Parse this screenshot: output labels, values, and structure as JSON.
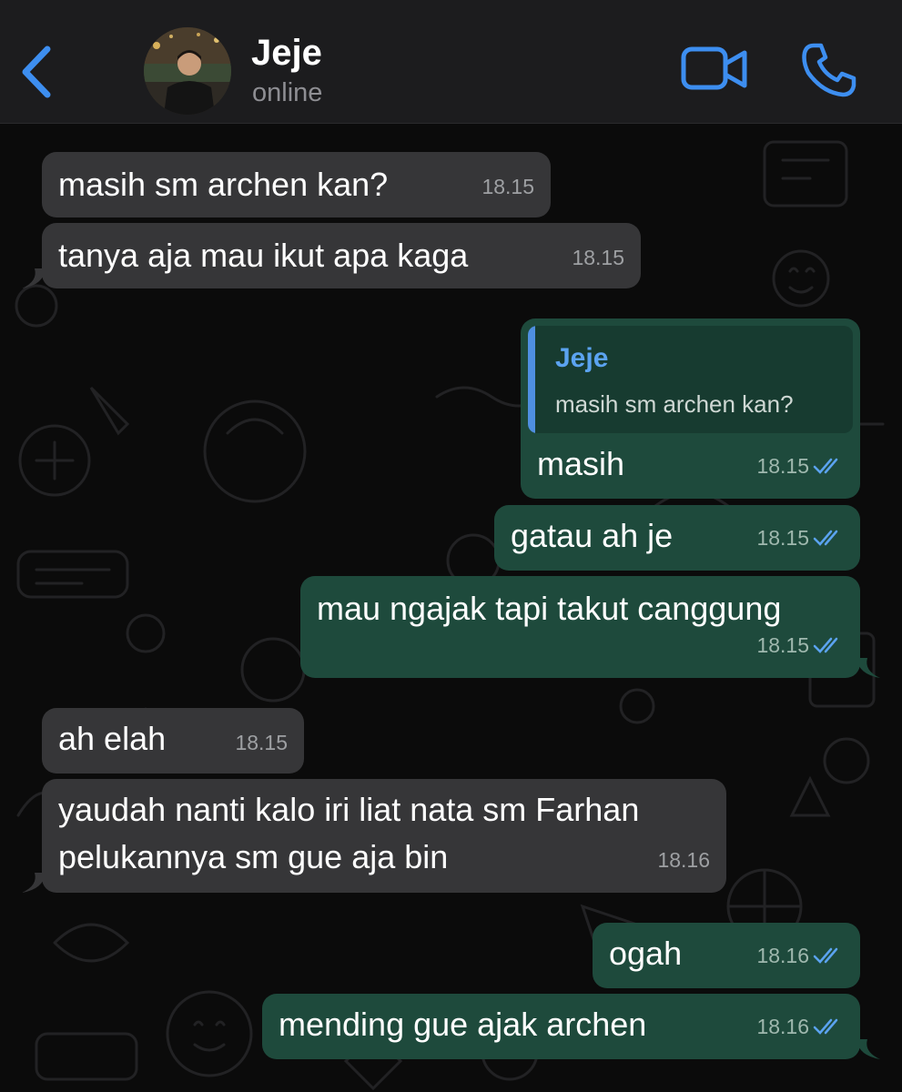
{
  "header": {
    "contact_name": "Jeje",
    "status": "online"
  },
  "colors": {
    "accent": "#3d8ef0",
    "incoming_bubble": "#363638",
    "outgoing_bubble": "#1e4a3c",
    "header_bg": "#1c1c1e"
  },
  "icons": {
    "back": "chevron-left-icon",
    "video": "video-camera-icon",
    "call": "phone-icon",
    "read": "double-check-icon"
  },
  "messages": [
    {
      "direction": "incoming",
      "text": "masih sm archen kan?",
      "time": "18.15"
    },
    {
      "direction": "incoming",
      "text": "tanya aja mau ikut apa kaga",
      "time": "18.15"
    },
    {
      "direction": "outgoing",
      "reply_to": {
        "name": "Jeje",
        "text": "masih sm archen kan?"
      },
      "text": "masih",
      "time": "18.15",
      "read": true
    },
    {
      "direction": "outgoing",
      "text": "gatau ah je",
      "time": "18.15",
      "read": true
    },
    {
      "direction": "outgoing",
      "text": "mau ngajak tapi takut canggung",
      "time": "18.15",
      "read": true
    },
    {
      "direction": "incoming",
      "text": "ah elah",
      "time": "18.15"
    },
    {
      "direction": "incoming",
      "text": "yaudah nanti kalo iri liat nata sm Farhan",
      "text_line2": "pelukannya sm gue aja bin",
      "time": "18.16"
    },
    {
      "direction": "outgoing",
      "text": "ogah",
      "time": "18.16",
      "read": true
    },
    {
      "direction": "outgoing",
      "text": "mending gue ajak archen",
      "time": "18.16",
      "read": true
    }
  ]
}
